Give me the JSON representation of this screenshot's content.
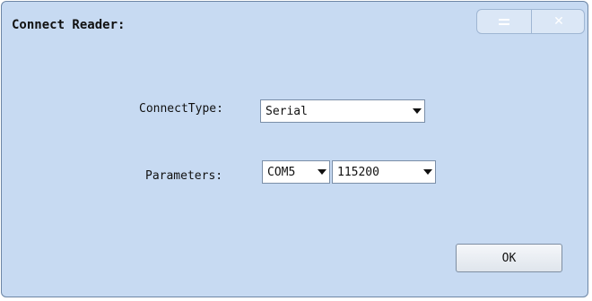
{
  "dialog": {
    "title": "Connect Reader:",
    "menu_icon": "menu-icon",
    "close_icon": "close-icon"
  },
  "form": {
    "connect_type_label": "ConnectType:",
    "connect_type_value": "Serial",
    "parameters_label": "Parameters:",
    "port_value": "COM5",
    "baud_value": "115200"
  },
  "buttons": {
    "ok_label": "OK"
  }
}
